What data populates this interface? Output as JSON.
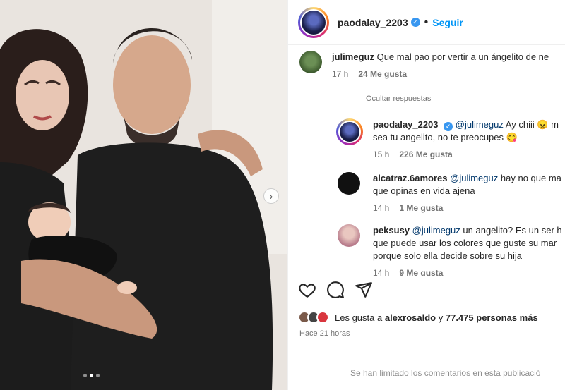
{
  "post": {
    "author": "paodalay_2203",
    "follow_label": "Seguir",
    "follow_separator": "•",
    "carousel": {
      "total": 3,
      "active": 2
    }
  },
  "comments": [
    {
      "user": "julimeguz",
      "text": "Que mal pao por vertir a un ángelito de ne",
      "time": "17 h",
      "likes": "24 Me gusta"
    },
    {
      "user": "paodalay_2203",
      "mention": "@julimeguz",
      "text_line1": "Ay chiii 😠 m",
      "text_line2": "sea tu angelito, no te preocupes 😋",
      "time": "15 h",
      "likes": "226 Me gusta"
    },
    {
      "user": "alcatraz.6amores",
      "mention": "@julimeguz",
      "text_line1": "hay no que ma",
      "text_line2": "que opinas en vida ajena",
      "time": "14 h",
      "likes": "1 Me gusta"
    },
    {
      "user": "peksusy",
      "mention": "@julimeguz",
      "text_line1": "un angelito? Es un ser h",
      "text_line2": "que puede usar los colores que guste su mar",
      "text_line3": "porque solo ella decide sobre su hija",
      "time": "14 h",
      "likes": "9 Me gusta"
    }
  ],
  "replies_toggle": "Ocultar respuestas",
  "likes_summary": {
    "prefix": "Les gusta a",
    "user": "alexrosaldo",
    "connector": "y",
    "count": "77.475",
    "suffix": "personas más"
  },
  "posted_time": "Hace 21 horas",
  "comments_limited": "Se han limitado los comentarios en esta publicació",
  "icons": [
    "heart-icon",
    "comment-icon",
    "share-icon",
    "verified-badge-icon",
    "chevron-right-icon"
  ],
  "colors": {
    "accent": "#0095f6",
    "verified": "#3897f0",
    "mention": "#00376b",
    "muted": "#737373"
  }
}
